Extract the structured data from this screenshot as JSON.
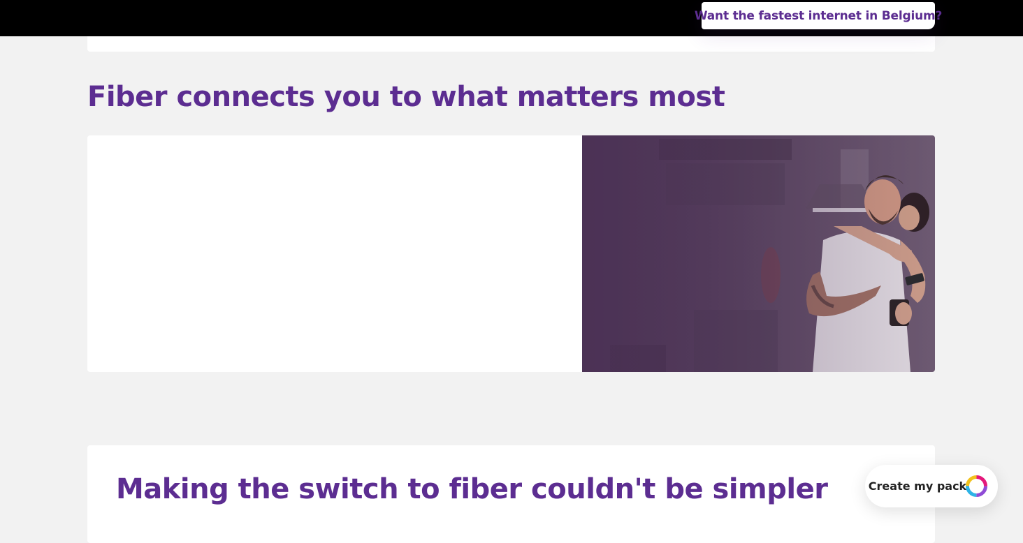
{
  "header": {
    "cta_label": "Want the fastest internet in Belgium?"
  },
  "main": {
    "section_title": "Fiber connects you to what matters most",
    "feature_image_alt": "Couple smiling at a phone in a kitchen",
    "switch_title": "Making the switch to fiber couldn't be simpler"
  },
  "floating": {
    "pack_button_label": "Create my pack",
    "pack_icon": "multicolor-ring-icon"
  },
  "colors": {
    "brand_purple": "#5c2d91",
    "page_background": "#f2f2f2",
    "top_bar": "#000000"
  }
}
